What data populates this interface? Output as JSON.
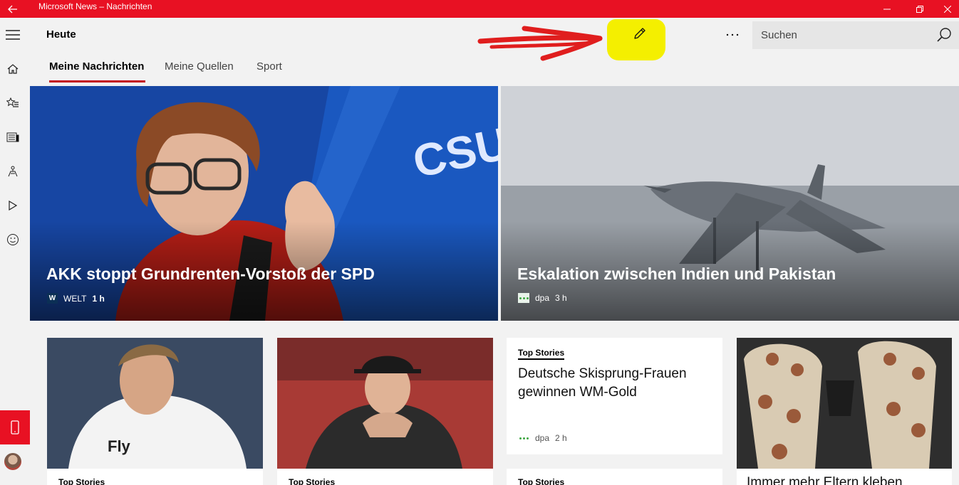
{
  "window": {
    "title": "Microsoft News – Nachrichten",
    "back_icon": "back-arrow-icon"
  },
  "header": {
    "title": "Heute",
    "search_placeholder": "Suchen"
  },
  "tabs": [
    {
      "label": "Meine Nachrichten",
      "active": true
    },
    {
      "label": "Meine Quellen",
      "active": false
    },
    {
      "label": "Sport",
      "active": false
    }
  ],
  "rail": {
    "items": [
      "home-icon",
      "favorites-icon",
      "news-icon",
      "local-icon",
      "video-icon",
      "emoji-icon"
    ]
  },
  "hero": [
    {
      "headline": "AKK stoppt Grundrenten-Vorstoß der SPD",
      "source_logo": "W",
      "source": "WELT",
      "age": "1 h"
    },
    {
      "headline": "Eskalation zwischen Indien und Pakistan",
      "source": "dpa",
      "age": "3 h"
    }
  ],
  "cards": [
    {
      "tag": "Top Stories"
    },
    {
      "tag": "Top Stories"
    },
    {
      "tag": "Top Stories",
      "headline": "Deutsche Skisprung-Frauen gewinnen WM-Gold",
      "source": "dpa",
      "age": "2 h"
    },
    {
      "tag": "Top Stories"
    },
    {
      "headline": "Immer mehr Eltern kleben"
    }
  ],
  "colors": {
    "brand": "#e81123",
    "tab_underline": "#c30a1a",
    "annotation_highlight": "#f4ef00",
    "annotation_arrow": "#e01e1e"
  }
}
